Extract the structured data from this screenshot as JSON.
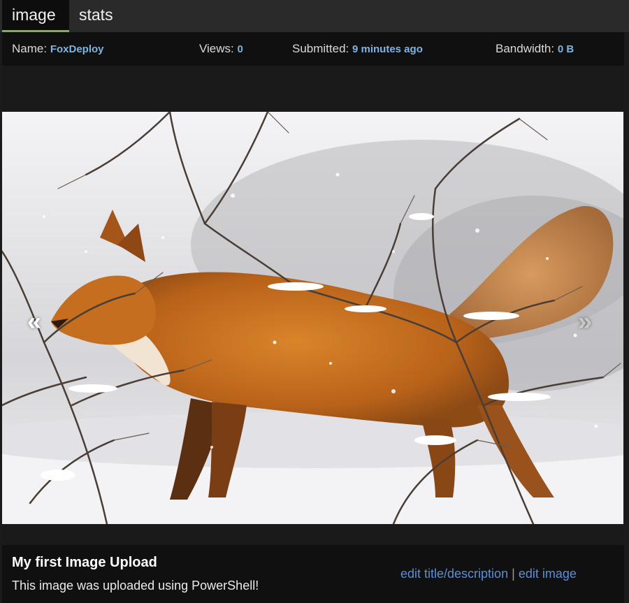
{
  "tabs": [
    {
      "label": "image",
      "active": true
    },
    {
      "label": "stats",
      "active": false
    }
  ],
  "stats": {
    "name_label": "Name:",
    "name_value": "FoxDeploy",
    "views_label": "Views:",
    "views_value": "0",
    "submitted_label": "Submitted:",
    "submitted_value": "9 minutes ago",
    "bandwidth_label": "Bandwidth:",
    "bandwidth_value": "0 B"
  },
  "image": {
    "alt": "Red fox walking through snowy branches",
    "prev_glyph": "«",
    "next_glyph": "»"
  },
  "post": {
    "title": "My first Image Upload",
    "description": "This image was uploaded using PowerShell!",
    "edit_title_label": "edit title/description",
    "separator": "|",
    "edit_image_label": "edit image"
  },
  "colors": {
    "accent_tab": "#7ab648",
    "link": "#5b8fd6",
    "stat_value": "#7fb3e0"
  }
}
